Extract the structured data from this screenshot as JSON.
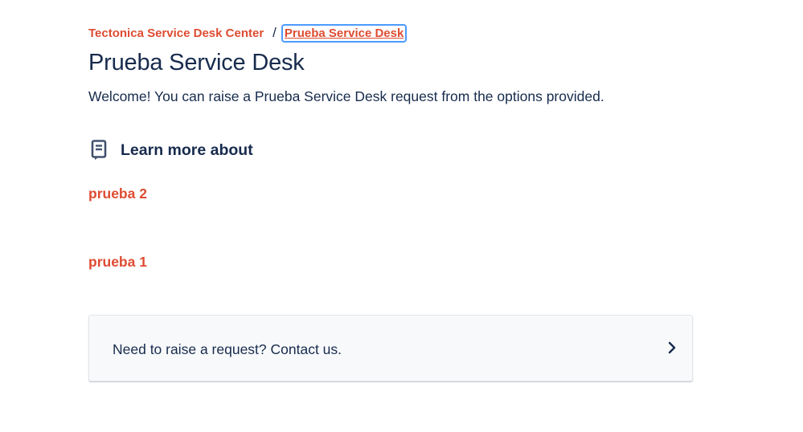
{
  "breadcrumb": {
    "parent": "Tectonica Service Desk Center",
    "separator": "/",
    "current": "Prueba Service Desk"
  },
  "header": {
    "title": "Prueba Service Desk",
    "welcome": "Welcome! You can raise a Prueba Service Desk request from the options provided."
  },
  "learn_more": {
    "icon": "book-icon",
    "title": "Learn more about",
    "articles": [
      {
        "label": "prueba 2"
      },
      {
        "label": "prueba 1"
      }
    ]
  },
  "contact": {
    "text": "Need to raise a request? Contact us.",
    "icon": "chevron-right-icon"
  },
  "colors": {
    "link": "#de4c32",
    "text": "#172b4d",
    "focus": "#4c9aff",
    "card_bg": "#f8f9fb"
  }
}
